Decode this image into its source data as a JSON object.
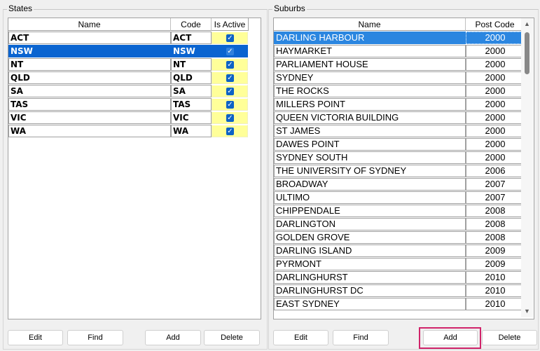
{
  "states_panel": {
    "title": "States",
    "columns": [
      "Name",
      "Code",
      "Is Active"
    ],
    "rows": [
      {
        "name": "ACT",
        "code": "ACT"
      },
      {
        "name": "NSW",
        "code": "NSW"
      },
      {
        "name": "NT",
        "code": "NT"
      },
      {
        "name": "QLD",
        "code": "QLD"
      },
      {
        "name": "SA",
        "code": "SA"
      },
      {
        "name": "TAS",
        "code": "TAS"
      },
      {
        "name": "VIC",
        "code": "VIC"
      },
      {
        "name": "WA",
        "code": "WA"
      }
    ],
    "buttons": {
      "edit": "Edit",
      "find": "Find",
      "add": "Add",
      "delete": "Delete"
    }
  },
  "suburbs_panel": {
    "title": "Suburbs",
    "columns": [
      "Name",
      "Post Code"
    ],
    "rows": [
      {
        "name": "DARLING HARBOUR",
        "post_code": "2000"
      },
      {
        "name": "HAYMARKET",
        "post_code": "2000"
      },
      {
        "name": "PARLIAMENT HOUSE",
        "post_code": "2000"
      },
      {
        "name": "SYDNEY",
        "post_code": "2000"
      },
      {
        "name": "THE ROCKS",
        "post_code": "2000"
      },
      {
        "name": "MILLERS POINT",
        "post_code": "2000"
      },
      {
        "name": "QUEEN VICTORIA BUILDING",
        "post_code": "2000"
      },
      {
        "name": "ST JAMES",
        "post_code": "2000"
      },
      {
        "name": "DAWES POINT",
        "post_code": "2000"
      },
      {
        "name": "SYDNEY SOUTH",
        "post_code": "2000"
      },
      {
        "name": "THE UNIVERSITY OF SYDNEY",
        "post_code": "2006"
      },
      {
        "name": "BROADWAY",
        "post_code": "2007"
      },
      {
        "name": "ULTIMO",
        "post_code": "2007"
      },
      {
        "name": "CHIPPENDALE",
        "post_code": "2008"
      },
      {
        "name": "DARLINGTON",
        "post_code": "2008"
      },
      {
        "name": "GOLDEN GROVE",
        "post_code": "2008"
      },
      {
        "name": "DARLING ISLAND",
        "post_code": "2009"
      },
      {
        "name": "PYRMONT",
        "post_code": "2009"
      },
      {
        "name": "DARLINGHURST",
        "post_code": "2010"
      },
      {
        "name": "DARLINGHURST DC",
        "post_code": "2010"
      },
      {
        "name": "EAST SYDNEY",
        "post_code": "2010"
      }
    ],
    "buttons": {
      "edit": "Edit",
      "find": "Find",
      "add": "Add",
      "delete": "Delete"
    }
  },
  "colors": {
    "selection": "#0a64d0",
    "active_cell": "#ffff99",
    "highlight": "#d0246a"
  },
  "icons": {
    "checkbox": "checkmark-icon",
    "scroll_up": "scroll-up-arrow-icon",
    "scroll_down": "scroll-down-arrow-icon"
  }
}
